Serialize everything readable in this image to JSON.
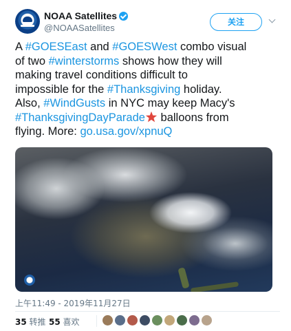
{
  "author": {
    "display_name": "NOAA Satellites",
    "handle": "@NOAASatellites"
  },
  "follow_button": {
    "label": "关注"
  },
  "tweet": {
    "lines": [
      [
        {
          "t": "A ",
          "link": false
        },
        {
          "t": "#GOESEast",
          "link": true
        },
        {
          "t": " and ",
          "link": false
        },
        {
          "t": "#GOESWest",
          "link": true
        },
        {
          "t": " combo visual",
          "link": false
        }
      ],
      [
        {
          "t": "of two ",
          "link": false
        },
        {
          "t": "#winterstorms",
          "link": true
        },
        {
          "t": " shows how they will",
          "link": false
        }
      ],
      [
        {
          "t": "making travel conditions difficult to",
          "link": false
        }
      ],
      [
        {
          "t": "impossible for the ",
          "link": false
        },
        {
          "t": "#Thanksgiving",
          "link": true
        },
        {
          "t": " holiday.",
          "link": false
        }
      ],
      [
        {
          "t": "Also, ",
          "link": false
        },
        {
          "t": "#WindGusts",
          "link": true
        },
        {
          "t": " in NYC may keep Macy's",
          "link": false
        }
      ],
      [
        {
          "t": "#ThanksgivingDayParade",
          "link": true
        },
        {
          "emoji": "starfish"
        },
        {
          "t": " balloons from",
          "link": false
        }
      ],
      [
        {
          "t": "flying. More: ",
          "link": false
        },
        {
          "t": "go.usa.gov/xpnuQ",
          "link": true
        }
      ]
    ]
  },
  "timestamp": "上午11:49 - 2019年11月27日",
  "stats": {
    "retweets_count": "35",
    "retweets_label": "转推",
    "likes_count": "55",
    "likes_label": "喜欢"
  },
  "likers": [
    {
      "icon": "liker-avatar-1",
      "color": "#9a7b5a"
    },
    {
      "icon": "liker-avatar-2",
      "color": "#5a6e8a"
    },
    {
      "icon": "liker-avatar-3",
      "color": "#b35a4a"
    },
    {
      "icon": "liker-avatar-4",
      "color": "#3d4c63"
    },
    {
      "icon": "liker-avatar-5",
      "color": "#6b8f5e"
    },
    {
      "icon": "liker-avatar-6",
      "color": "#c2a77a"
    },
    {
      "icon": "liker-avatar-7",
      "color": "#4a6d4a"
    },
    {
      "icon": "liker-avatar-8",
      "color": "#7d6c8f"
    },
    {
      "icon": "liker-avatar-9",
      "color": "#b8a38c"
    }
  ],
  "colors": {
    "link": "#1b95e0",
    "accent": "#1da1f2",
    "muted": "#657786",
    "starfish": "#e0463d"
  }
}
